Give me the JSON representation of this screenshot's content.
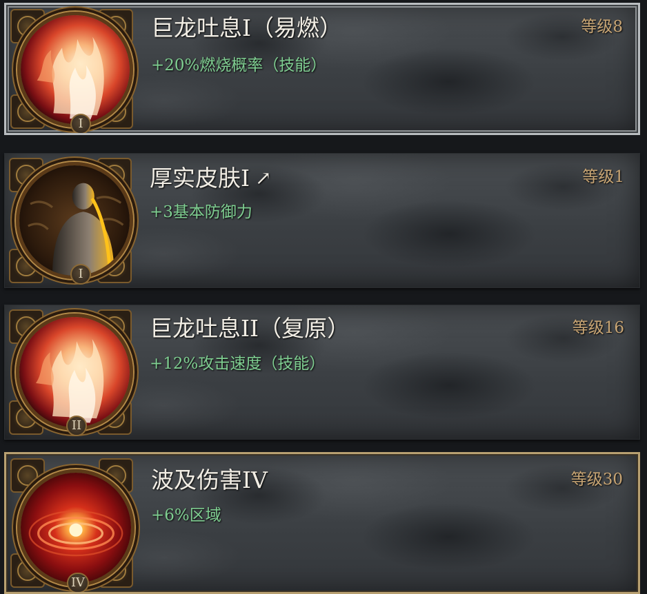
{
  "skills": [
    {
      "title": "巨龙吐息I（易燃）",
      "stat": "+20%燃烧概率（技能）",
      "level": "等级8",
      "numeral": "I",
      "icon": "fire-breath-icon",
      "selected": true
    },
    {
      "title": "厚实皮肤I",
      "stat": "+3基本防御力",
      "level": "等级1",
      "numeral": "I",
      "icon": "thick-skin-icon",
      "arrow": "↗"
    },
    {
      "title": "巨龙吐息II（复原）",
      "stat": "+12%攻击速度（技能）",
      "level": "等级16",
      "numeral": "II",
      "icon": "fire-breath-icon"
    },
    {
      "title": "波及伤害IV",
      "stat": "+6%区域",
      "level": "等级30",
      "numeral": "IV",
      "icon": "area-damage-icon",
      "highlighted": true
    }
  ],
  "colors": {
    "title": "#f1ede4",
    "stat": "#7fce91",
    "level": "#c8a574",
    "selected_border": "#b9bdc0",
    "highlight_border": "#b8a071"
  }
}
